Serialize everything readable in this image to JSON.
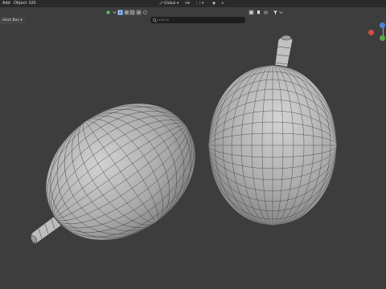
{
  "menu": {
    "add": "Add",
    "object": "Object",
    "gis": "GIS"
  },
  "header": {
    "select_mode": "elect Box",
    "chevron": "▾"
  },
  "transform": {
    "orientation": "Global"
  },
  "search": {
    "placeholder": "Search"
  },
  "colors": {
    "viewport_bg": "#3d3d3d",
    "header_bg": "#2a2a2a",
    "mesh_fill": "#b6b6b6",
    "wire": "#3a3a3a",
    "active_blue": "#4f7fbf",
    "axis_x": "#d84b4b",
    "axis_y": "#5aa84b",
    "axis_z": "#4b82d8"
  },
  "icons": [
    "green-dot-icon",
    "solid-shading-icon",
    "wireframe-shading-icon",
    "material-shading-icon",
    "rendered-shading-icon",
    "search-icon",
    "pivot-icon",
    "snap-icon",
    "proportional-icon",
    "mesh-select-icon",
    "filter-icon",
    "gizmo-y-icon",
    "gizmo-x-icon",
    "gizmo-z-icon"
  ]
}
